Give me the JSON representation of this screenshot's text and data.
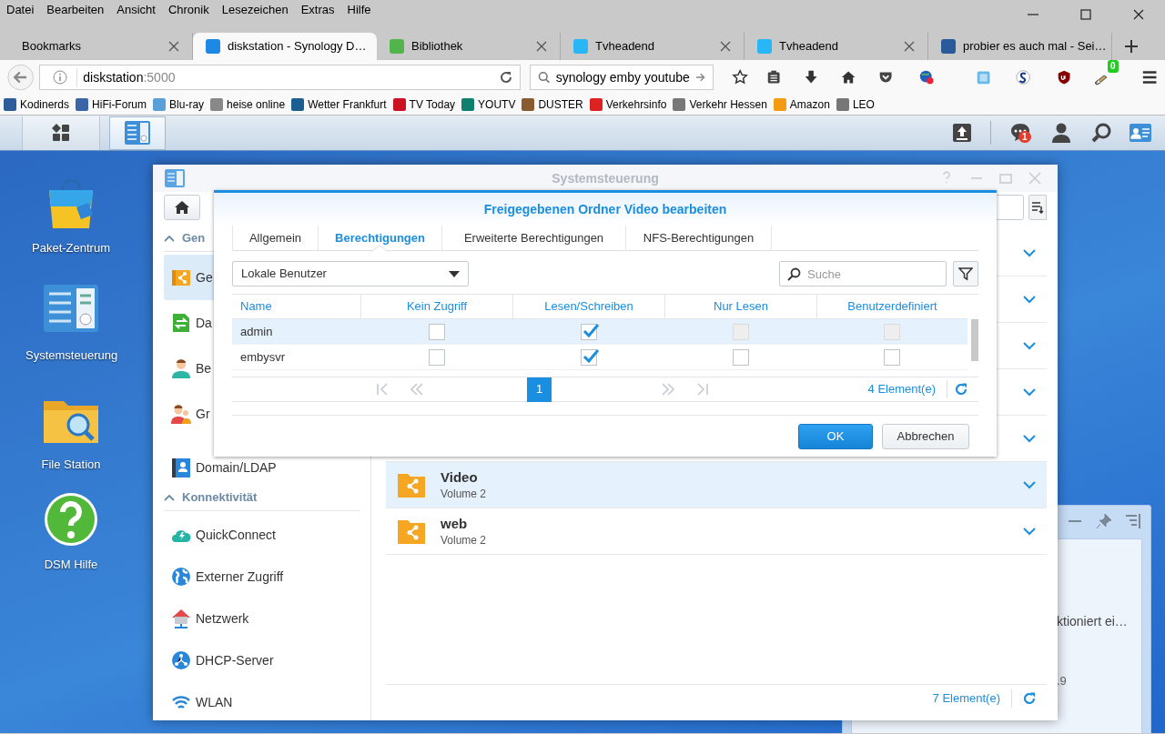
{
  "browser": {
    "menu": [
      "Datei",
      "Bearbeiten",
      "Ansicht",
      "Chronik",
      "Lesezeichen",
      "Extras",
      "Hilfe"
    ],
    "tabs": [
      {
        "title": "Bookmarks",
        "selected": false
      },
      {
        "title": "diskstation - Synology D…",
        "selected": true,
        "color": "#1e88e5"
      },
      {
        "title": "Bibliothek",
        "selected": false,
        "color": "#52b54b"
      },
      {
        "title": "Tvheadend",
        "selected": false,
        "color": "#29b6f6"
      },
      {
        "title": "Tvheadend",
        "selected": false,
        "color": "#29b6f6"
      },
      {
        "title": "probier es auch mal - Sei…",
        "selected": false,
        "color": "#2a5a9a"
      }
    ],
    "address": {
      "host": "diskstation",
      "port": ":5000"
    },
    "search": {
      "value": "synology emby youtube"
    },
    "addon_badge": "0",
    "bookmarks": [
      {
        "label": "Kodinerds",
        "color": "#2d5d9a"
      },
      {
        "label": "HiFi-Forum",
        "color": "#3a66a8"
      },
      {
        "label": "Blu-ray",
        "color": "#5aa0d8"
      },
      {
        "label": "heise online",
        "color": "#888888"
      },
      {
        "label": "Wetter Frankfurt",
        "color": "#1a5f8f"
      },
      {
        "label": "TV Today",
        "color": "#cc1122"
      },
      {
        "label": "YOUTV",
        "color": "#0f7f6f"
      },
      {
        "label": "DUSTER",
        "color": "#8a5a30"
      },
      {
        "label": "Verkehrsinfo",
        "color": "#dd2222"
      },
      {
        "label": "Verkehr Hessen",
        "color": "#777777"
      },
      {
        "label": "Amazon",
        "color": "#f39c12"
      },
      {
        "label": "LEO",
        "color": "#777777"
      }
    ]
  },
  "dsm": {
    "taskbar": {
      "notification_count": "1"
    },
    "desktop_icons": [
      {
        "label": "Paket-Zentrum"
      },
      {
        "label": "Systemsteuerung"
      },
      {
        "label": "File Station"
      },
      {
        "label": "DSM Hilfe"
      }
    ],
    "control_panel": {
      "title": "Systemsteuerung",
      "sidebar": [
        {
          "kind": "header",
          "label": "Gen",
          "expanded": true
        },
        {
          "kind": "item",
          "label": "Ge",
          "selected": true
        },
        {
          "kind": "item",
          "label": "Da",
          "selected": false
        },
        {
          "kind": "item",
          "label": "Be",
          "selected": false
        },
        {
          "kind": "item",
          "label": "Gr",
          "selected": false
        },
        {
          "kind": "item",
          "label": "Domain/LDAP",
          "selected": false
        },
        {
          "kind": "header",
          "label": "Konnektivität",
          "expanded": true
        },
        {
          "kind": "item",
          "label": "QuickConnect",
          "selected": false
        },
        {
          "kind": "item",
          "label": "Externer Zugriff",
          "selected": false
        },
        {
          "kind": "item",
          "label": "Netzwerk",
          "selected": false
        },
        {
          "kind": "item",
          "label": "DHCP-Server",
          "selected": false
        },
        {
          "kind": "item",
          "label": "WLAN",
          "selected": false
        }
      ],
      "shares": [
        {
          "selected": false
        },
        {
          "selected": false
        },
        {
          "selected": false
        },
        {
          "selected": false
        },
        {
          "selected": false
        },
        {
          "name": "Video",
          "volume": "Volume 2",
          "selected": true
        },
        {
          "name": "web",
          "volume": "Volume 2",
          "selected": false
        }
      ],
      "count": "7 Element(e)"
    },
    "dialog": {
      "title": "Freigegebenen Ordner Video bearbeiten",
      "tabs": [
        {
          "label": "Allgemein",
          "selected": false
        },
        {
          "label": "Berechtigungen",
          "selected": true
        },
        {
          "label": "Erweiterte Berechtigungen",
          "selected": false
        },
        {
          "label": "NFS-Berechtigungen",
          "selected": false
        }
      ],
      "user_type": "Lokale Benutzer",
      "search": {
        "placeholder": "Suche"
      },
      "columns": [
        "Name",
        "Kein Zugriff",
        "Lesen/Schreiben",
        "Nur Lesen",
        "Benutzerdefiniert"
      ],
      "rows": [
        {
          "name": "admin",
          "selected": true,
          "cells": [
            {
              "checked": false,
              "disabled": false
            },
            {
              "checked": true,
              "disabled": false
            },
            {
              "checked": false,
              "disabled": true
            },
            {
              "checked": false,
              "disabled": true
            }
          ]
        },
        {
          "name": "embysvr",
          "selected": false,
          "cells": [
            {
              "checked": false,
              "disabled": false
            },
            {
              "checked": true,
              "disabled": false
            },
            {
              "checked": false,
              "disabled": false
            },
            {
              "checked": false,
              "disabled": false
            }
          ]
        }
      ],
      "pages": [
        {
          "label": "1",
          "selected": true
        }
      ],
      "count": "4 Element(e)",
      "buttons": [
        {
          "label": "OK",
          "kind": "primary"
        },
        {
          "label": "Abbrechen",
          "kind": "secondary"
        }
      ]
    },
    "notification": {
      "lines": [
        "ktioniert ei…",
        ".9"
      ]
    }
  }
}
